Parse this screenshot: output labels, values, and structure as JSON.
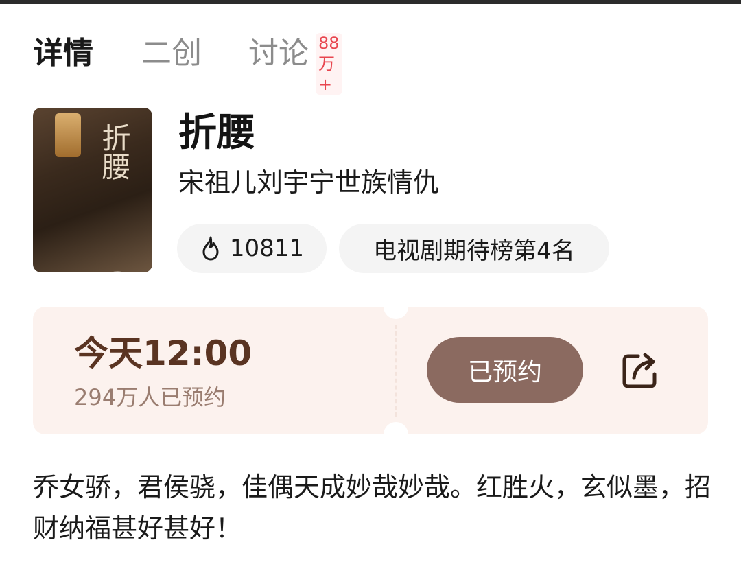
{
  "tabs": [
    {
      "label": "详情",
      "active": true
    },
    {
      "label": "二创",
      "active": false
    },
    {
      "label": "讨论",
      "active": false,
      "badge": "88万+"
    }
  ],
  "show": {
    "title": "折腰",
    "subtitle": "宋祖儿刘宇宁世族情仇",
    "poster_icon": "poster-image"
  },
  "chips": {
    "heat_icon": "flame-icon",
    "heat_value": "10811",
    "rank_label": "电视剧期待榜第4名"
  },
  "booking": {
    "time": "今天12:00",
    "count": "294万人已预约",
    "button_label": "已预约",
    "share_icon": "share-icon"
  },
  "description": "乔女骄，君侯骁，佳偶天成妙哉妙哉。红胜火，玄似墨，招财纳福甚好甚好！",
  "colors": {
    "tab_active": "#1a1a1a",
    "tab_inactive": "#8c8c8c",
    "badge_text": "#e8464f",
    "booking_bg": "#fcf2ee",
    "booking_text": "#5a3422",
    "button_bg": "#8b6a60"
  }
}
